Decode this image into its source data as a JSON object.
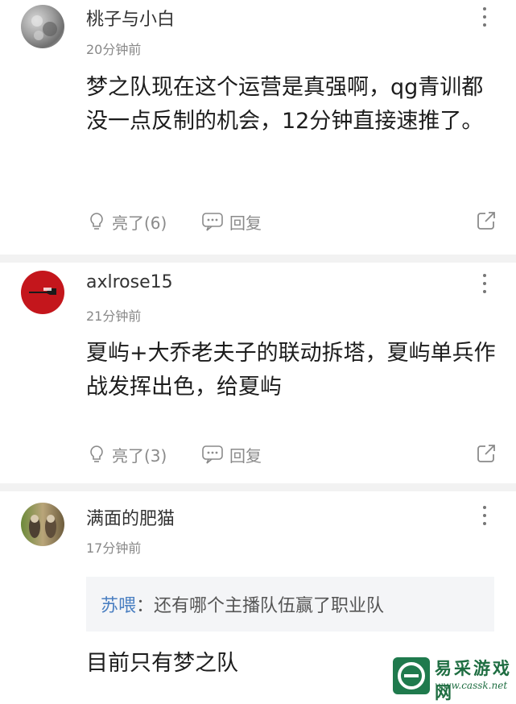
{
  "comments": [
    {
      "username": "桃子与小白",
      "time": "20分钟前",
      "text": "梦之队现在这个运营是真强啊，qg青训都没一点反制的机会，12分钟直接速推了。",
      "like_label": "亮了(6)",
      "reply_label": "回复"
    },
    {
      "username": "axlrose15",
      "time": "21分钟前",
      "text": "夏屿+大乔老夫子的联动拆塔，夏屿单兵作战发挥出色，给夏屿",
      "like_label": "亮了(3)",
      "reply_label": "回复"
    },
    {
      "username": "满面的肥猫",
      "time": "17分钟前",
      "quote": {
        "name": "苏喂",
        "separator": "：",
        "text": "还有哪个主播队伍赢了职业队"
      },
      "text": "目前只有梦之队"
    }
  ],
  "watermark": {
    "title": "易采游戏网",
    "url": "www.cassk.net"
  },
  "icons": {
    "like": "lightbulb-icon",
    "reply": "chat-bubble-icon",
    "share": "share-icon",
    "more": "more-vertical-icon"
  },
  "colors": {
    "quote_name": "#4a7fc1",
    "action_gray": "#8a8a8a",
    "divider": "#f2f2f2"
  }
}
